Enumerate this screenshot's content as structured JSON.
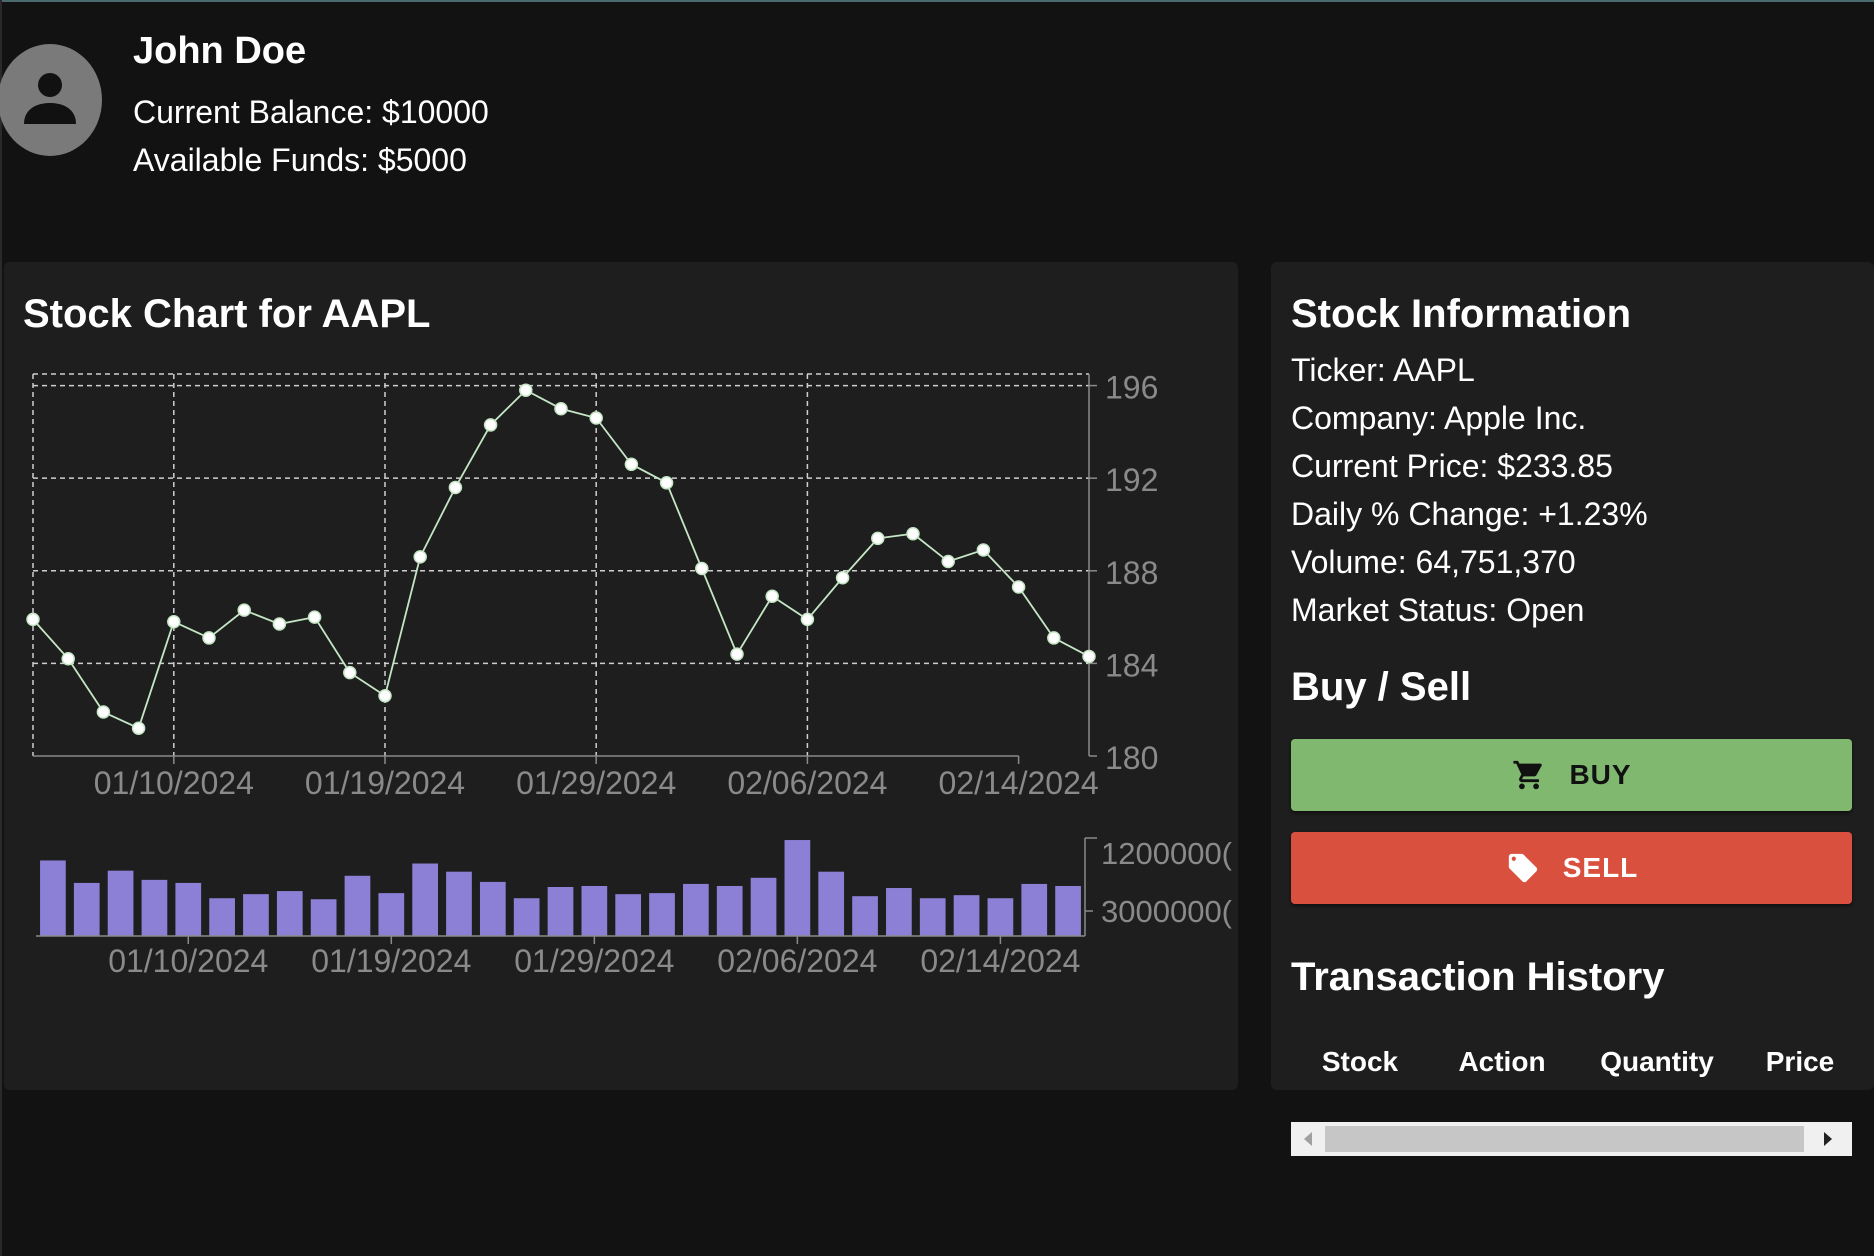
{
  "profile": {
    "name": "John Doe",
    "balance": "Current Balance: $10000",
    "funds": "Available Funds: $5000",
    "avatar_icon": "person-icon"
  },
  "chart_panel": {
    "title": "Stock Chart for AAPL"
  },
  "chart_data": [
    {
      "type": "line",
      "x": [
        "01/04/2024",
        "01/05/2024",
        "01/08/2024",
        "01/09/2024",
        "01/10/2024",
        "01/11/2024",
        "01/12/2024",
        "01/16/2024",
        "01/17/2024",
        "01/18/2024",
        "01/19/2024",
        "01/22/2024",
        "01/23/2024",
        "01/24/2024",
        "01/25/2024",
        "01/26/2024",
        "01/29/2024",
        "01/30/2024",
        "01/31/2024",
        "02/01/2024",
        "02/02/2024",
        "02/05/2024",
        "02/06/2024",
        "02/07/2024",
        "02/08/2024",
        "02/09/2024",
        "02/12/2024",
        "02/13/2024",
        "02/14/2024",
        "02/15/2024",
        "02/16/2024"
      ],
      "values": [
        185.9,
        184.2,
        181.9,
        181.2,
        185.8,
        185.1,
        186.3,
        185.7,
        186.0,
        183.6,
        182.6,
        188.6,
        191.6,
        194.3,
        195.8,
        195.0,
        194.6,
        192.6,
        191.8,
        188.1,
        184.4,
        186.9,
        185.9,
        187.7,
        189.4,
        189.6,
        188.4,
        188.9,
        187.3,
        185.1,
        184.3
      ],
      "xticks": [
        "01/10/2024",
        "01/19/2024",
        "01/29/2024",
        "02/06/2024",
        "02/14/2024"
      ],
      "yticks": [
        180,
        184,
        188,
        192,
        196
      ],
      "ylim": [
        180,
        196.5
      ],
      "grid": true,
      "line_color": "#c4e6c4",
      "y_axis_side": "right"
    },
    {
      "type": "bar",
      "values": [
        74000000,
        52000000,
        64000000,
        55000000,
        52000000,
        37000000,
        41000000,
        44000000,
        36000000,
        59000000,
        42000000,
        71000000,
        63000000,
        53000000,
        37000000,
        48000000,
        49000000,
        41000000,
        42000000,
        51000000,
        49000000,
        57000000,
        94000000,
        63000000,
        39000000,
        47000000,
        37000000,
        40000000,
        37000000,
        51000000,
        49000000
      ],
      "xticks": [
        "01/10/2024",
        "01/19/2024",
        "01/29/2024",
        "02/06/2024",
        "02/14/2024"
      ],
      "yticks": [
        "3000000(",
        "1200000("
      ],
      "ylim": [
        0,
        96000000
      ],
      "bar_color": "#8b80d6",
      "y_axis_side": "right"
    }
  ],
  "info_panel": {
    "title": "Stock Information",
    "lines": [
      "Ticker: AAPL",
      "Company: Apple Inc.",
      "Current Price: $233.85",
      "Daily % Change: +1.23%",
      "Volume: 64,751,370",
      "Market Status: Open"
    ],
    "trade_title": "Buy / Sell",
    "buy_label": "BUY",
    "sell_label": "SELL",
    "buy_icon": "cart-icon",
    "sell_icon": "tag-icon",
    "buy_color": "#81b86f",
    "sell_color": "#d9503f",
    "history_title": "Transaction History",
    "history_columns": [
      "Stock",
      "Action",
      "Quantity",
      "Price"
    ]
  }
}
